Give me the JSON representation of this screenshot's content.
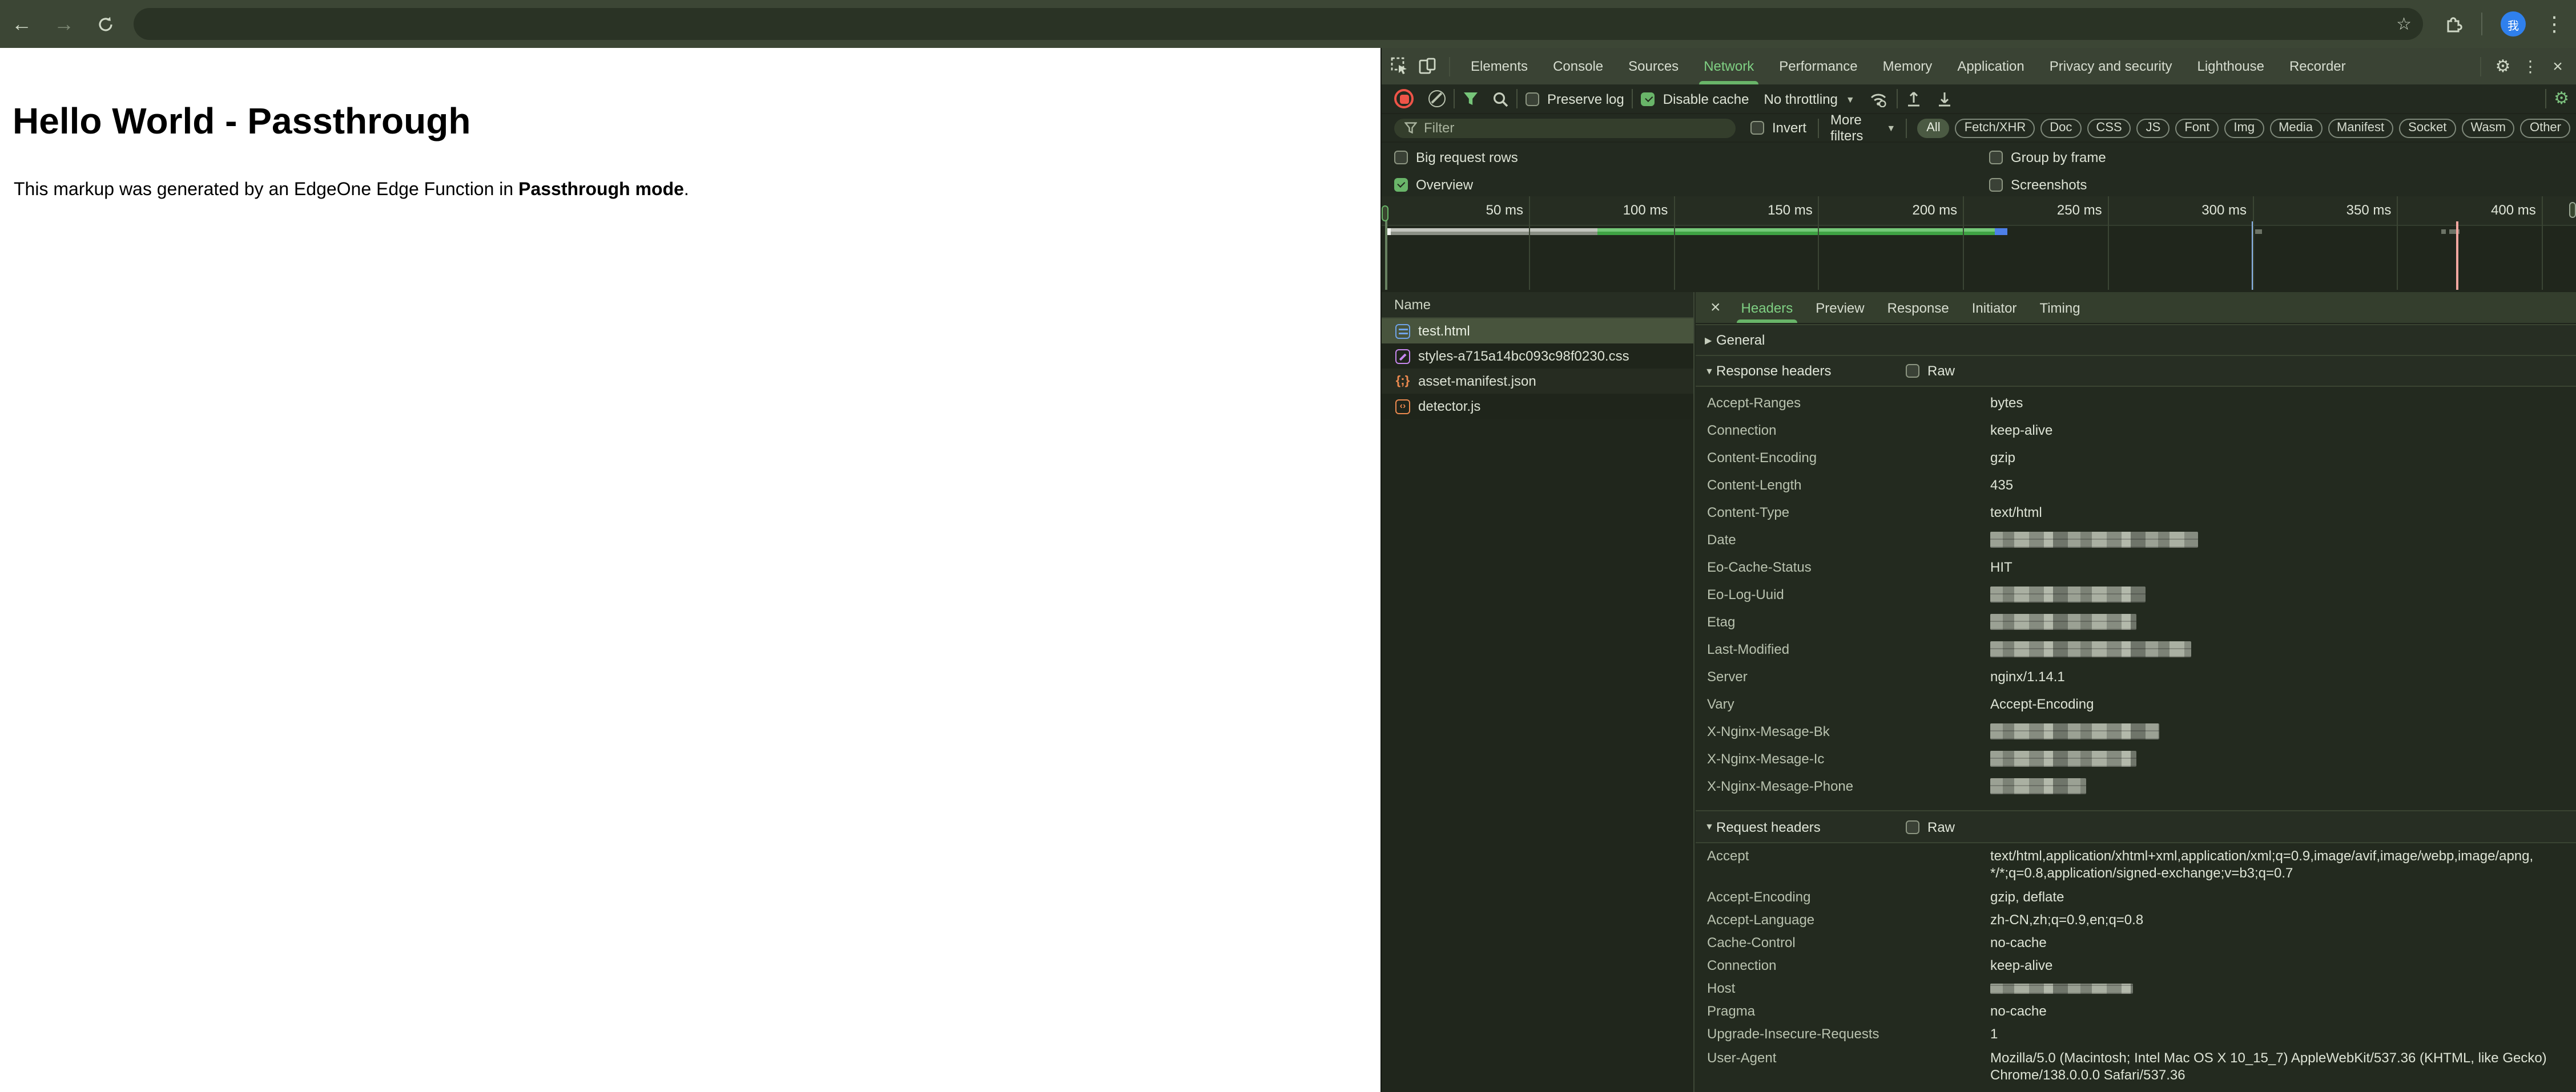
{
  "browser": {
    "icons": [
      "back-arrow",
      "forward-arrow",
      "reload",
      "bookmark-star",
      "extensions-puzzle",
      "profile-avatar",
      "menu-kebab"
    ],
    "avatar_glyph": "我",
    "url_redacted": true
  },
  "page": {
    "heading": "Hello World - Passthrough",
    "body_prefix": "This markup was generated by an EdgeOne Edge Function in ",
    "body_bold": "Passthrough mode",
    "body_suffix": "."
  },
  "devtools": {
    "main_tabs": [
      "Elements",
      "Console",
      "Sources",
      "Network",
      "Performance",
      "Memory",
      "Application",
      "Privacy and security",
      "Lighthouse",
      "Recorder"
    ],
    "active_tab": "Network",
    "toolbar": {
      "preserve_log": {
        "label": "Preserve log",
        "checked": false
      },
      "disable_cache": {
        "label": "Disable cache",
        "checked": true
      },
      "throttling": "No throttling"
    },
    "filter": {
      "placeholder": "Filter",
      "invert": {
        "label": "Invert",
        "checked": false
      },
      "more_filters": "More filters",
      "chips": [
        "All",
        "Fetch/XHR",
        "Doc",
        "CSS",
        "JS",
        "Font",
        "Img",
        "Media",
        "Manifest",
        "Socket",
        "Wasm",
        "Other"
      ],
      "active_chip": "All"
    },
    "options": {
      "big_request_rows": {
        "label": "Big request rows",
        "checked": false
      },
      "overview": {
        "label": "Overview",
        "checked": true
      },
      "group_by_frame": {
        "label": "Group by frame",
        "checked": false
      },
      "screenshots": {
        "label": "Screenshots",
        "checked": false
      }
    },
    "timeline": {
      "ticks": [
        "50 ms",
        "100 ms",
        "150 ms",
        "200 ms",
        "250 ms",
        "300 ms",
        "350 ms",
        "400 ms"
      ],
      "bar_segments_ms": {
        "gray": [
          2,
          74
        ],
        "green": [
          74,
          212
        ],
        "blue": [
          212,
          216
        ]
      },
      "dom_content_loaded_ms": 300,
      "load_event_ms": 371
    },
    "requests": {
      "column": "Name",
      "rows": [
        {
          "name": "test.html",
          "type": "doc",
          "selected": true
        },
        {
          "name": "styles-a715a14bc093c98f0230.css",
          "type": "css",
          "selected": false
        },
        {
          "name": "asset-manifest.json",
          "type": "json",
          "selected": false
        },
        {
          "name": "detector.js",
          "type": "js",
          "selected": false
        }
      ]
    },
    "details": {
      "tabs": [
        "Headers",
        "Preview",
        "Response",
        "Initiator",
        "Timing"
      ],
      "active_tab": "Headers",
      "sections": {
        "general": "General",
        "response": "Response headers",
        "request": "Request headers",
        "raw": "Raw"
      },
      "response_headers": [
        {
          "name": "Accept-Ranges",
          "value": "bytes"
        },
        {
          "name": "Connection",
          "value": "keep-alive"
        },
        {
          "name": "Content-Encoding",
          "value": "gzip"
        },
        {
          "name": "Content-Length",
          "value": "435"
        },
        {
          "name": "Content-Type",
          "value": "text/html"
        },
        {
          "name": "Date",
          "value": "",
          "redacted": true
        },
        {
          "name": "Eo-Cache-Status",
          "value": "HIT"
        },
        {
          "name": "Eo-Log-Uuid",
          "value": "",
          "redacted": true
        },
        {
          "name": "Etag",
          "value": "",
          "redacted": true
        },
        {
          "name": "Last-Modified",
          "value": "",
          "redacted": true
        },
        {
          "name": "Server",
          "value": "nginx/1.14.1"
        },
        {
          "name": "Vary",
          "value": "Accept-Encoding"
        },
        {
          "name": "X-Nginx-Mesage-Bk",
          "value": "",
          "redacted": true
        },
        {
          "name": "X-Nginx-Mesage-Ic",
          "value": "",
          "redacted": true
        },
        {
          "name": "X-Nginx-Mesage-Phone",
          "value": "",
          "redacted": true
        }
      ],
      "request_headers": [
        {
          "name": "Accept",
          "value": "text/html,application/xhtml+xml,application/xml;q=0.9,image/avif,image/webp,image/apng,\n*/*;q=0.8,application/signed-exchange;v=b3;q=0.7"
        },
        {
          "name": "Accept-Encoding",
          "value": "gzip, deflate"
        },
        {
          "name": "Accept-Language",
          "value": "zh-CN,zh;q=0.9,en;q=0.8"
        },
        {
          "name": "Cache-Control",
          "value": "no-cache"
        },
        {
          "name": "Connection",
          "value": "keep-alive"
        },
        {
          "name": "Host",
          "value": "",
          "redacted": true
        },
        {
          "name": "Pragma",
          "value": "no-cache"
        },
        {
          "name": "Upgrade-Insecure-Requests",
          "value": "1"
        },
        {
          "name": "User-Agent",
          "value": "Mozilla/5.0 (Macintosh; Intel Mac OS X 10_15_7) AppleWebKit/537.36 (KHTML, like Gecko)\nChrome/138.0.0.0 Safari/537.36"
        }
      ]
    }
  }
}
